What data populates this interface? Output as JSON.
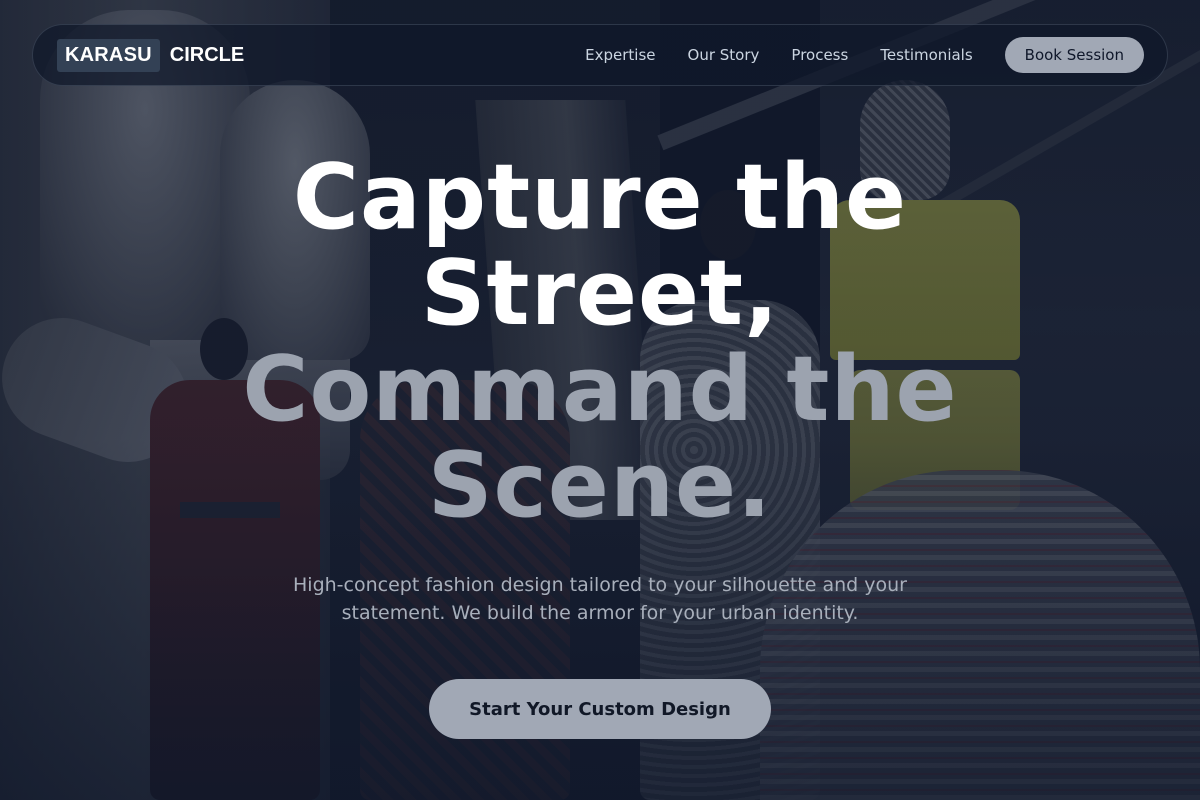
{
  "brand": {
    "mark": "KARASU",
    "word": "CIRCLE"
  },
  "nav": {
    "links": [
      "Expertise",
      "Our Story",
      "Process",
      "Testimonials"
    ],
    "cta_label": "Book Session"
  },
  "hero": {
    "headline_light": [
      "Capture the",
      "Street,"
    ],
    "headline_muted": [
      "Command the",
      "Scene."
    ],
    "subtitle": "High-concept fashion design tailored to your silhouette and your statement. We build the armor for your urban identity.",
    "cta_label": "Start Your Custom Design"
  },
  "colors": {
    "background": "#0f172a",
    "button": "#a1a8b5",
    "headline_light": "#ffffff",
    "headline_muted": "#9ca3af",
    "nav_text": "#cbd5e1"
  }
}
